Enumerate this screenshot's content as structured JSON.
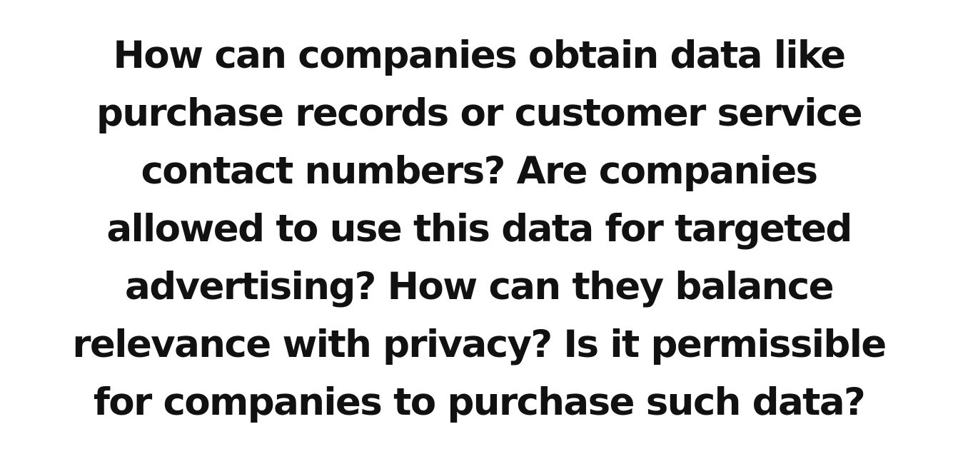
{
  "text_lines": [
    "How can companies obtain data like",
    "purchase records or customer service",
    "contact numbers? Are companies",
    "allowed to use this data for targeted",
    "advertising? How can they balance",
    "relevance with privacy? Is it permissible",
    "for companies to purchase such data?"
  ],
  "colors": {
    "background": "#ffffff",
    "text": "#111111"
  }
}
